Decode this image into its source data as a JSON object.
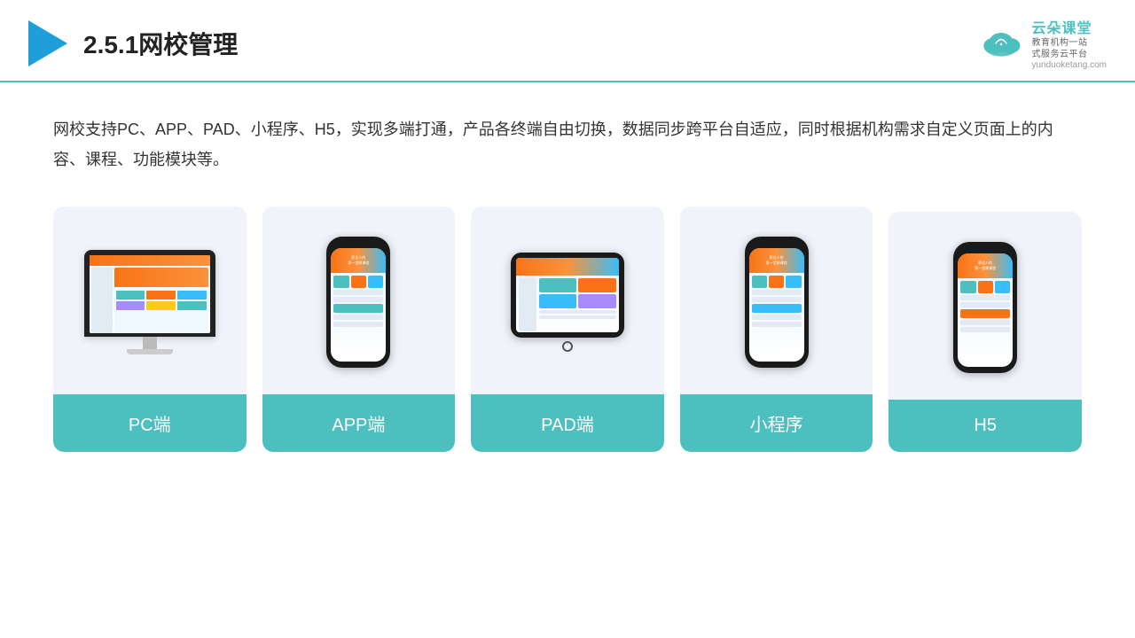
{
  "header": {
    "title": "2.5.1网校管理",
    "brand": {
      "name": "云朵课堂",
      "sub1": "教育机构一站",
      "sub2": "式服务云平台",
      "url": "yunduoketang.com"
    }
  },
  "description": "网校支持PC、APP、PAD、小程序、H5，实现多端打通，产品各终端自由切换，数据同步跨平台自适应，同时根据机构需求自定义页面上的内容、课程、功能模块等。",
  "cards": [
    {
      "id": "pc",
      "label": "PC端",
      "type": "monitor"
    },
    {
      "id": "app",
      "label": "APP端",
      "type": "phone"
    },
    {
      "id": "pad",
      "label": "PAD端",
      "type": "tablet"
    },
    {
      "id": "miniapp",
      "label": "小程序",
      "type": "phone"
    },
    {
      "id": "h5",
      "label": "H5",
      "type": "phone"
    }
  ],
  "colors": {
    "teal": "#4DBFBF",
    "accent_blue": "#1E9FD8",
    "header_border": "#4DBFBF"
  }
}
